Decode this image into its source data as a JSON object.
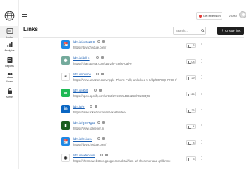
{
  "sidebar": {
    "items": [
      {
        "label": "Links",
        "icon": "link-icon",
        "active": true
      },
      {
        "label": "Analytics",
        "icon": "bar-chart-icon",
        "active": false
      },
      {
        "label": "Reports",
        "icon": "document-icon",
        "active": false
      },
      {
        "label": "Users",
        "icon": "users-icon",
        "active": false
      },
      {
        "label": "Admin",
        "icon": "lock-icon",
        "active": false
      }
    ]
  },
  "header": {
    "extension_label": "Get extension",
    "user_name": "Vikash"
  },
  "main": {
    "title": "Links",
    "search_placeholder": "Search...",
    "create_label": "Create link",
    "links": [
      {
        "short": "ldm.io/Ax6oZDC",
        "long": "https://dayschedule.com/",
        "clicks": "3",
        "icon": "dayschedule-icon",
        "icon_color": "#1e88e5",
        "icon_text": "📅"
      },
      {
        "short": "ldm.io/dall-e",
        "long": "https://chat.openai.com/g/g-2fkFE8rbu-dall-e",
        "clicks": "108",
        "icon": "openai-icon",
        "icon_color": "#74aa9c",
        "icon_text": "✺"
      },
      {
        "short": "ldm.io/iphone",
        "long": "https://www.amazon.com/Apple-iPhone-Fully-Unlocked-5-8/dp/B07HQHRNDH/",
        "clicks": "29",
        "icon": "amazon-icon",
        "icon_color": "#ffffff",
        "icon_text": "a"
      },
      {
        "short": "ldm.io/d0jlt",
        "long": "https://open.spotify.com/artist/2YKXWoJB9d25Eh01634yB",
        "clicks": "125",
        "icon": "spotify-icon",
        "icon_color": "#1db954",
        "icon_text": "≋"
      },
      {
        "short": "ldm.io/vr",
        "long": "https://www.linkedin.com/in/vikashvirtee/",
        "clicks": "26",
        "icon": "linkedin-icon",
        "icon_color": "#0a66c2",
        "icon_text": "in"
      },
      {
        "short": "ldm.io/QO7Tg52",
        "long": "https://www.screener.in/",
        "clicks": "4",
        "icon": "screener-icon",
        "icon_color": "#1b5e20",
        "icon_text": "▮"
      },
      {
        "short": "ldm.io/H1ixeIu",
        "long": "https://dayschedule.com/",
        "clicks": "8",
        "icon": "dayschedule-icon",
        "icon_color": "#1e88e5",
        "icon_text": "📅"
      },
      {
        "short": "ldm.io/extension",
        "long": "https://chromewebstore.google.com/detail/ldm-url-shortener-and-qr/llbmnk",
        "clicks": "3",
        "icon": "chrome-icon",
        "icon_color": "#ffffff",
        "icon_text": "◉"
      }
    ]
  },
  "colors": {
    "create_button_bg": "#1f1f1f",
    "link_color": "#1a5fb4",
    "extension_dot": "#e53935"
  }
}
